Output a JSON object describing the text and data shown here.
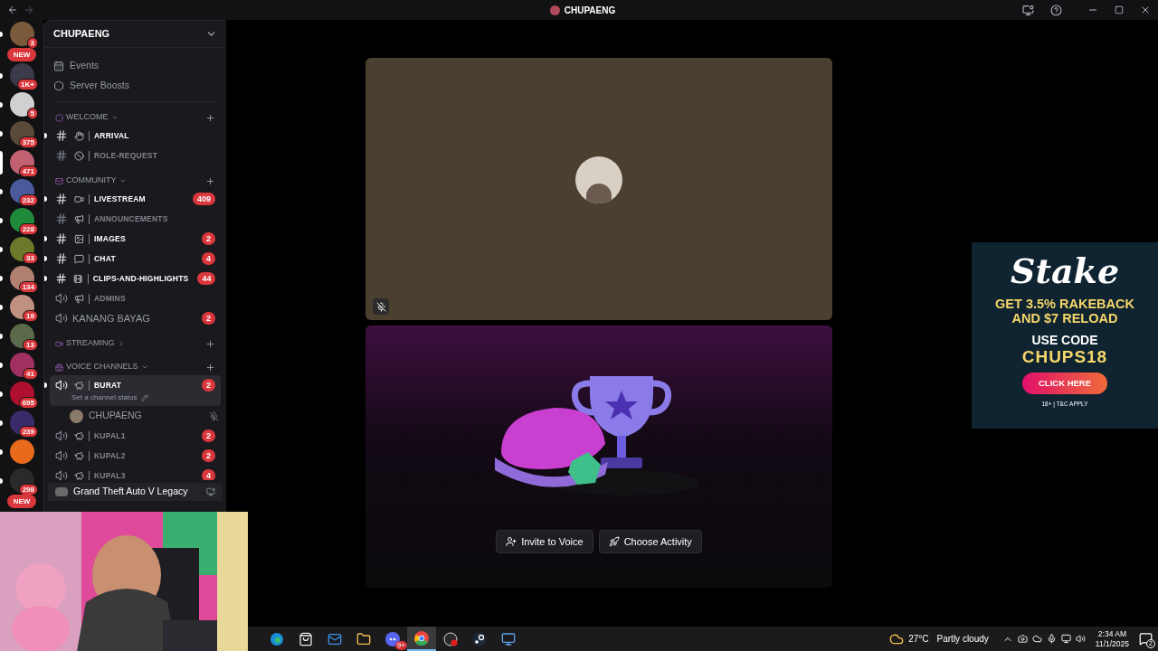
{
  "window": {
    "title": "CHUPAENG"
  },
  "servers": [
    {
      "kind": "server",
      "badge": "3",
      "selected": false
    },
    {
      "kind": "new",
      "badge": "NEW"
    },
    {
      "kind": "server",
      "badge": "1K+",
      "selected": false
    },
    {
      "kind": "server",
      "badge": "5",
      "selected": false
    },
    {
      "kind": "server",
      "badge": "375",
      "selected": false
    },
    {
      "kind": "server",
      "badge": "471",
      "selected": true
    },
    {
      "kind": "server",
      "badge": "232",
      "selected": false
    },
    {
      "kind": "server",
      "badge": "228",
      "selected": false
    },
    {
      "kind": "server",
      "badge": "33",
      "selected": false
    },
    {
      "kind": "server",
      "badge": "134",
      "selected": false
    },
    {
      "kind": "server",
      "badge": "19",
      "selected": false
    },
    {
      "kind": "server",
      "badge": "13",
      "selected": false
    },
    {
      "kind": "server",
      "badge": "41",
      "selected": false
    },
    {
      "kind": "server",
      "badge": "695",
      "selected": false
    },
    {
      "kind": "server",
      "badge": "239",
      "selected": false
    },
    {
      "kind": "server",
      "selected": false
    },
    {
      "kind": "server",
      "badge": "298",
      "selected": false
    },
    {
      "kind": "new",
      "badge": "NEW"
    }
  ],
  "server_name": "CHUPAENG",
  "server_links": [
    {
      "kind": "events",
      "label": "Events"
    },
    {
      "kind": "boosts",
      "label": "Server Boosts"
    }
  ],
  "categories": [
    {
      "name": "WELCOME",
      "expanded": true,
      "channels": [
        {
          "kind": "text",
          "name": "ARRIVAL",
          "unread": true,
          "selected": false
        },
        {
          "kind": "text",
          "name": "ROLE-REQUEST",
          "unread": false,
          "selected": false
        }
      ]
    },
    {
      "name": "COMMUNITY",
      "expanded": true,
      "channels": [
        {
          "kind": "text",
          "name": "LIVESTREAM",
          "unread": true,
          "badge": "409",
          "selected": false
        },
        {
          "kind": "text",
          "name": "ANNOUNCEMENTS",
          "unread": false,
          "selected": false
        },
        {
          "kind": "text",
          "name": "IMAGES",
          "unread": true,
          "badge": "2",
          "selected": false
        },
        {
          "kind": "text",
          "name": "CHAT",
          "unread": true,
          "badge": "4",
          "selected": false
        },
        {
          "kind": "text",
          "name": "CLIPS-AND-HIGHLIGHTS",
          "unread": true,
          "badge": "44",
          "selected": false
        },
        {
          "kind": "voice",
          "name": "ADMINS",
          "unread": false,
          "selected": false
        },
        {
          "kind": "voice",
          "name": "KANANG BAYAG",
          "unread": false,
          "badge": "2",
          "selected": false
        }
      ]
    },
    {
      "name": "STREAMING",
      "expanded": false
    },
    {
      "name": "VOICE CHANNELS",
      "expanded": true,
      "channels": [
        {
          "kind": "voice",
          "name": "BURAT",
          "unread": true,
          "badge": "2",
          "selected": true,
          "status": "Set a channel status",
          "members": [
            {
              "name": "CHUPAENG",
              "muted": true
            }
          ]
        },
        {
          "kind": "voice",
          "name": "KUPAL1",
          "unread": false,
          "badge": "2",
          "selected": false
        },
        {
          "kind": "voice",
          "name": "KUPAL2",
          "unread": false,
          "badge": "2",
          "selected": false
        },
        {
          "kind": "voice",
          "name": "KUPAL3",
          "unread": false,
          "badge": "4",
          "selected": false
        }
      ]
    }
  ],
  "activity": {
    "game": "Grand Theft Auto V Legacy"
  },
  "stage": {
    "participant_muted": true,
    "buttons": [
      {
        "kind": "invite",
        "label": "Invite to Voice"
      },
      {
        "kind": "activity",
        "label": "Choose Activity"
      }
    ]
  },
  "ad": {
    "brand": "Stake",
    "offer": "GET 3.5% RAKEBACK AND $7 RELOAD",
    "code_label": "USE CODE",
    "code": "CHUPS18",
    "button": "CLICK HERE",
    "legal": "18+ | T&C APPLY"
  },
  "taskbar": {
    "apps": [
      {
        "kind": "swirl",
        "active": false
      },
      {
        "kind": "store",
        "active": false
      },
      {
        "kind": "mail",
        "active": false
      },
      {
        "kind": "folder",
        "active": false
      },
      {
        "kind": "chat",
        "active": false,
        "badge": "9+"
      },
      {
        "kind": "browser",
        "active": true
      },
      {
        "kind": "record",
        "active": false
      },
      {
        "kind": "steam",
        "active": false
      },
      {
        "kind": "window",
        "active": false
      }
    ],
    "weather": {
      "temp": "27°C",
      "text": "Partly cloudy"
    },
    "time": "2:34 AM",
    "date": "11/1/2025",
    "notifications": "2"
  }
}
